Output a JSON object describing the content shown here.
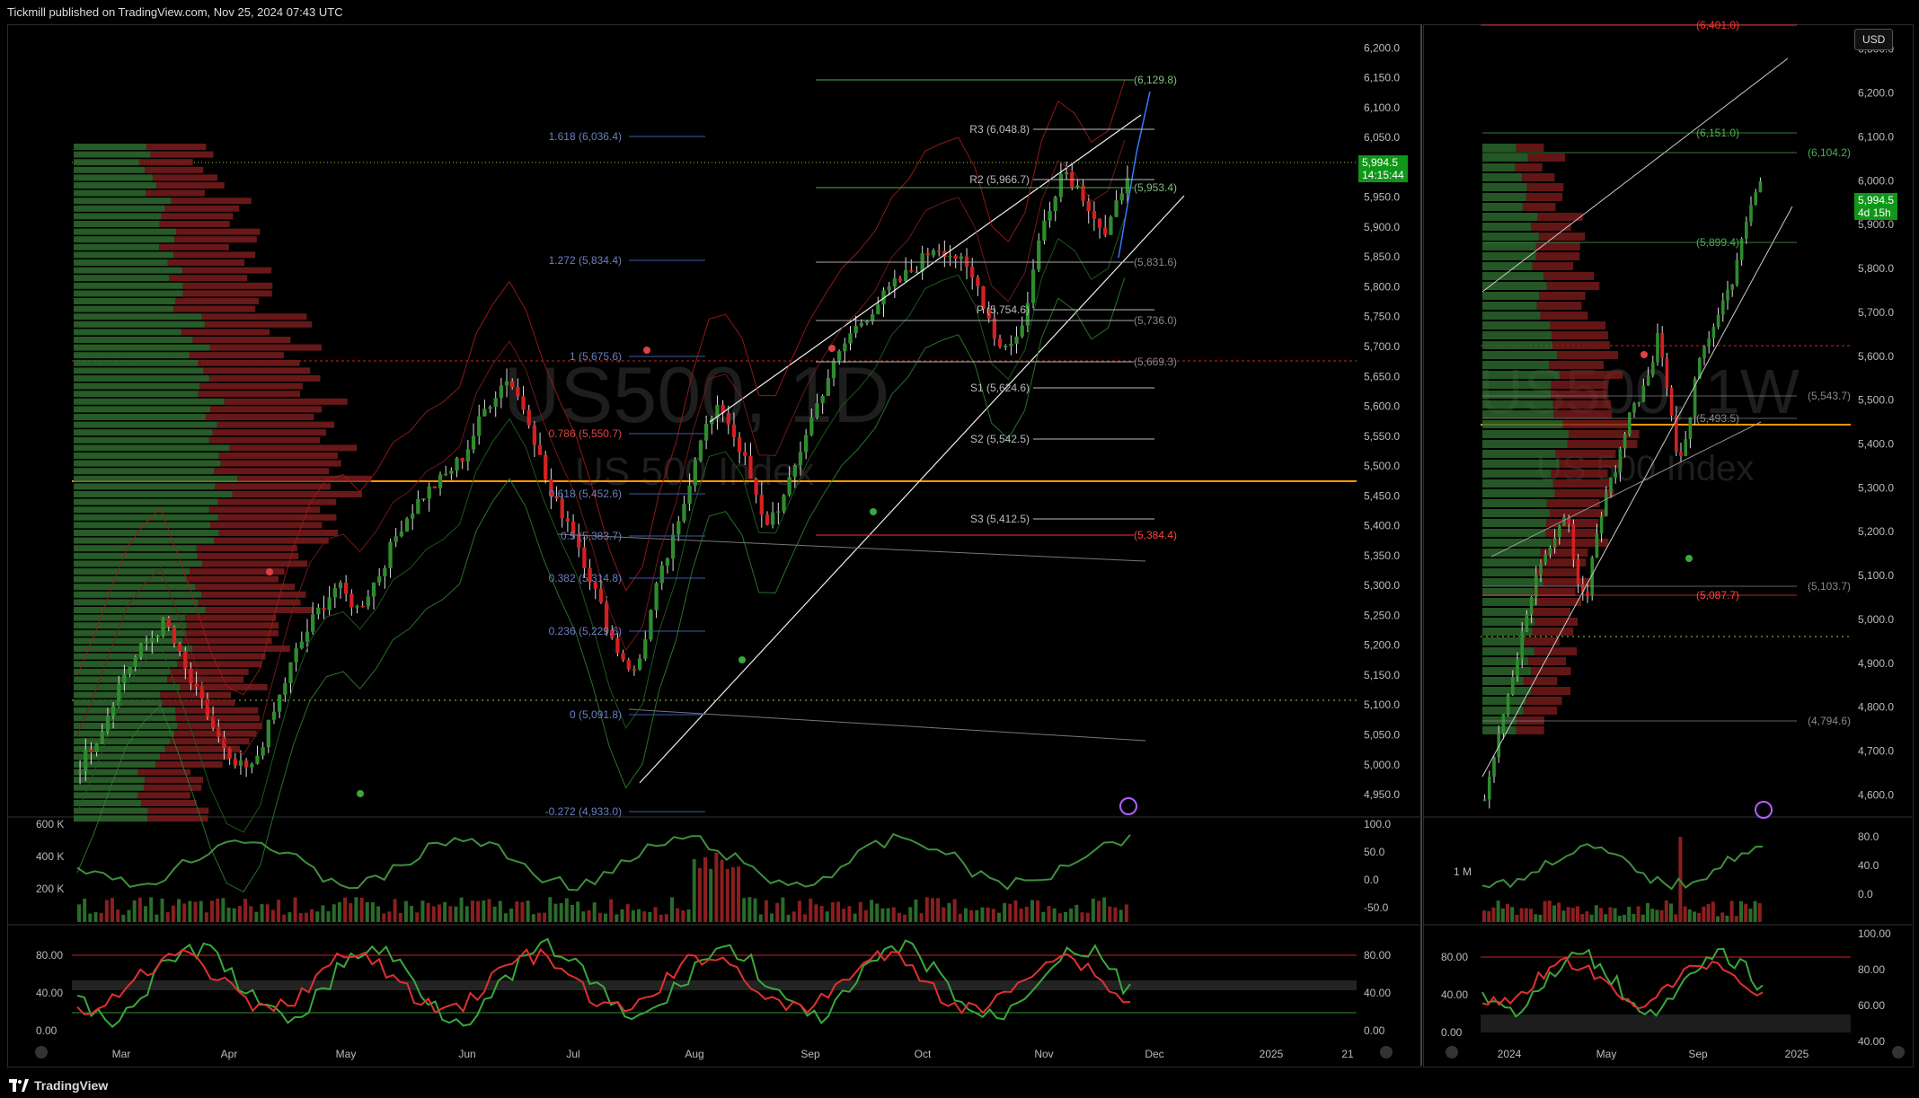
{
  "header": {
    "publisher": "Tickmill published on TradingView.com, Nov 25, 2024 07:43 UTC"
  },
  "footer": {
    "brand": "TradingView"
  },
  "colors": {
    "up": "#2e8b2e",
    "down": "#d42020",
    "accent_line": "#ff9800",
    "badge": "#109618"
  },
  "left_chart": {
    "watermark_symbol": "US500, 1D",
    "watermark_name": "US 500 Index",
    "last_price": "5,994.5",
    "countdown": "14:15:44",
    "price_axis": [
      "6,200.0",
      "6,150.0",
      "6,100.0",
      "6,050.0",
      "6,000.0",
      "5,950.0",
      "5,900.0",
      "5,850.0",
      "5,800.0",
      "5,750.0",
      "5,700.0",
      "5,650.0",
      "5,600.0",
      "5,550.0",
      "5,500.0",
      "5,450.0",
      "5,400.0",
      "5,350.0",
      "5,300.0",
      "5,250.0",
      "5,200.0",
      "5,150.0",
      "5,100.0",
      "5,050.0",
      "5,000.0",
      "4,950.0"
    ],
    "time_axis": [
      "Mar",
      "Apr",
      "May",
      "Jun",
      "Jul",
      "Aug",
      "Sep",
      "Oct",
      "Nov",
      "Dec",
      "2025",
      "21"
    ],
    "fib_labels": [
      "1.618 (6,036.4)",
      "1.272 (5,834.4)",
      "1 (5,675.6)",
      "0.786 (5,550.7)",
      "0.618 (5,452.6)",
      "0.5 (5,383.7)",
      "0.382 (5,314.8)",
      "0.236 (5,229.6)",
      "0 (5,091.8)",
      "-0.272 (4,933.0)"
    ],
    "pivot_labels": [
      "R3 (6,048.8)",
      "R2 (5,966.7)",
      "P (5,754.6)",
      "S1 (5,624.6)",
      "S2 (5,542.5)",
      "S3 (5,412.5)"
    ],
    "level_labels": [
      "(6,129.8)",
      "(5,953.4)",
      "(5,831.6)",
      "(5,736.0)",
      "(5,669.3)",
      "(5,384.4)"
    ],
    "volume_axis": [
      "600 K",
      "400 K",
      "200 K"
    ],
    "rsi_axis": [
      "100.0",
      "50.0",
      "0.0",
      "-50.0"
    ],
    "stoch_axis": [
      "80.00",
      "40.00",
      "0.00"
    ]
  },
  "right_chart": {
    "currency": "USD",
    "watermark_symbol": "US500, 1W",
    "watermark_name": "US 500 Index",
    "last_price": "5,994.5",
    "countdown": "4d 15h",
    "price_axis": [
      "6,300.0",
      "6,200.0",
      "6,100.0",
      "6,000.0",
      "5,900.0",
      "5,800.0",
      "5,700.0",
      "5,600.0",
      "5,500.0",
      "5,400.0",
      "5,300.0",
      "5,200.0",
      "5,100.0",
      "5,000.0",
      "4,900.0",
      "4,800.0",
      "4,700.0",
      "4,600.0"
    ],
    "time_axis": [
      "2024",
      "May",
      "Sep",
      "2025"
    ],
    "level_labels": [
      "(6,401.0)",
      "(6,151.0)",
      "(6,104.2)",
      "(5,899.4)",
      "(5,543.7)",
      "(5,493.5)",
      "(5,103.7)",
      "(5,087.7)",
      "(4,794.6)"
    ],
    "volume_axis": [
      "1 M"
    ],
    "rsi_axis": [
      "80.0",
      "40.0",
      "0.0"
    ],
    "stoch_axis_left": [
      "80.00",
      "40.00",
      "0.00"
    ],
    "stoch_axis_right": [
      "100.00",
      "80.00",
      "60.00",
      "40.00"
    ]
  },
  "chart_data": [
    {
      "type": "candlestick",
      "title": "US500, 1D",
      "ylim": [
        4920,
        6220
      ],
      "x_range": [
        "Feb 2024",
        "Dec 2024"
      ],
      "close_path": [
        5000,
        5060,
        5150,
        5200,
        5240,
        5150,
        5080,
        5000,
        4990,
        5080,
        5180,
        5250,
        5300,
        5260,
        5320,
        5400,
        5450,
        5480,
        5520,
        5600,
        5650,
        5580,
        5450,
        5400,
        5300,
        5200,
        5150,
        5300,
        5400,
        5550,
        5600,
        5520,
        5400,
        5450,
        5560,
        5650,
        5720,
        5760,
        5800,
        5830,
        5870,
        5850,
        5800,
        5700,
        5720,
        5900,
        6000,
        5950,
        5880,
        5994.5
      ]
    },
    {
      "type": "candlestick",
      "title": "US500, 1W",
      "ylim": [
        4560,
        6330
      ],
      "x_range": [
        "Nov 2023",
        "Dec 2024"
      ],
      "close_path": [
        4600,
        4700,
        4800,
        4900,
        5000,
        5100,
        5150,
        5200,
        5250,
        5100,
        5050,
        5200,
        5300,
        5350,
        5450,
        5500,
        5550,
        5650,
        5500,
        5350,
        5450,
        5600,
        5650,
        5700,
        5750,
        5850,
        5950,
        5994.5
      ]
    }
  ]
}
